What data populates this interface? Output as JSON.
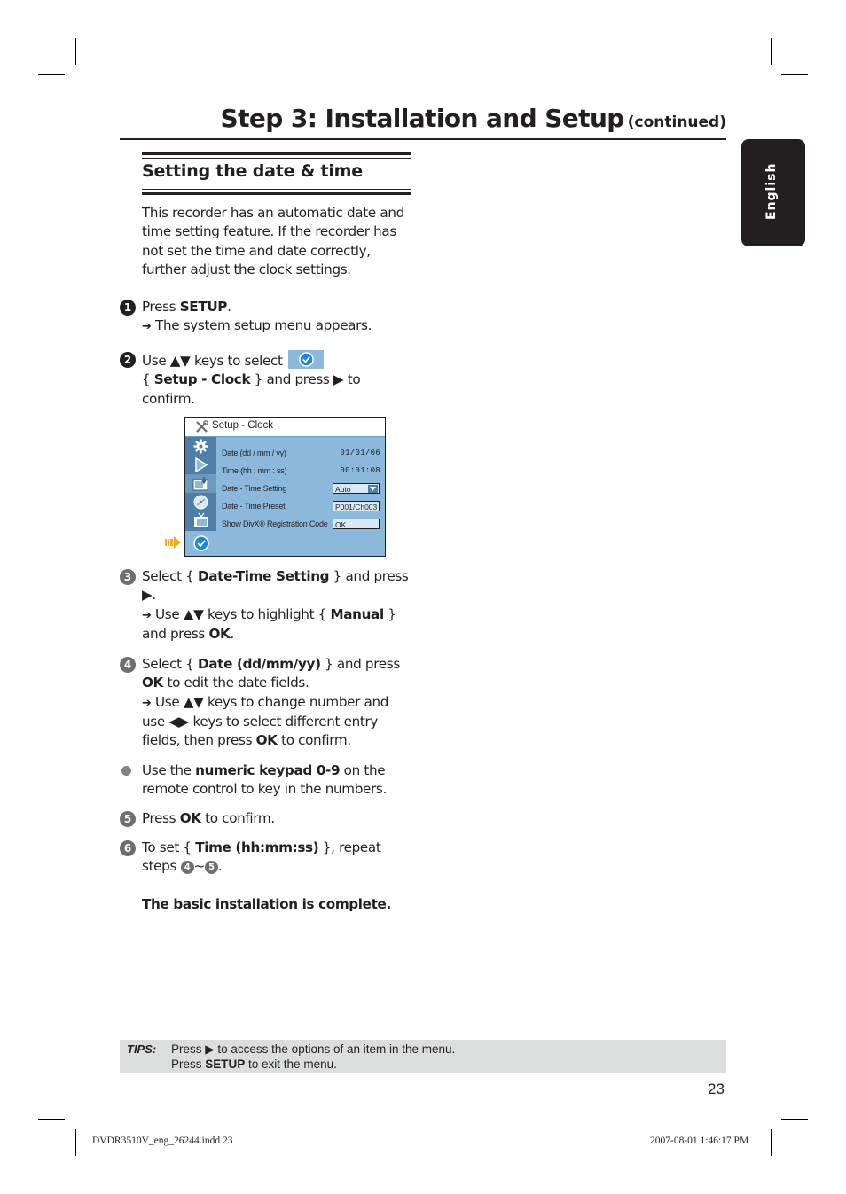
{
  "header": {
    "title": "Step 3: Installation and Setup",
    "continued": "(continued)"
  },
  "language_tab": "English",
  "section": {
    "title": "Setting the date & time",
    "intro": [
      "This recorder has an automatic date and",
      "time setting feature. If the recorder has",
      "not set the time and date correctly,",
      "further adjust the clock settings."
    ]
  },
  "steps": [
    {
      "num": "1",
      "lines": [
        {
          "parts": [
            {
              "t": "Press "
            },
            {
              "t": "SETUP",
              "b": true
            },
            {
              "t": "."
            }
          ]
        },
        {
          "arrow": true,
          "parts": [
            {
              "t": " The system setup menu appears."
            }
          ]
        }
      ]
    },
    {
      "num": "2",
      "lines": [
        {
          "parts": [
            {
              "t": "Use ▲▼ keys to select "
            }
          ],
          "chip": "clock-icon"
        },
        {
          "parts": [
            {
              "t": "{ "
            },
            {
              "t": "Setup - Clock",
              "b": true
            },
            {
              "t": " } and press ▶ to"
            }
          ]
        },
        {
          "parts": [
            {
              "t": "confirm."
            }
          ]
        }
      ]
    },
    {
      "num": "3",
      "lines": [
        {
          "parts": [
            {
              "t": "Select { "
            },
            {
              "t": "Date-Time Setting",
              "b": true
            },
            {
              "t": " } and press"
            }
          ]
        },
        {
          "parts": [
            {
              "t": "▶."
            }
          ]
        },
        {
          "arrow": true,
          "parts": [
            {
              "t": "  Use ▲▼ keys to highlight { "
            },
            {
              "t": "Manual",
              "b": true
            },
            {
              "t": " }"
            }
          ]
        },
        {
          "parts": [
            {
              "t": "and press "
            },
            {
              "t": "OK",
              "b": true
            },
            {
              "t": "."
            }
          ]
        }
      ]
    },
    {
      "num": "4",
      "lines": [
        {
          "parts": [
            {
              "t": "Select { "
            },
            {
              "t": "Date (dd/mm/yy)",
              "b": true
            },
            {
              "t": " } and press"
            }
          ]
        },
        {
          "parts": [
            {
              "t": "OK",
              "b": true
            },
            {
              "t": " to edit the date fields."
            }
          ]
        },
        {
          "arrow": true,
          "parts": [
            {
              "t": "  Use ▲▼ keys to change number and"
            }
          ]
        },
        {
          "parts": [
            {
              "t": "use ◀▶ keys to select different entry"
            }
          ]
        },
        {
          "parts": [
            {
              "t": "fields, then press "
            },
            {
              "t": "OK",
              "b": true
            },
            {
              "t": " to confirm."
            }
          ]
        }
      ]
    },
    {
      "bullet": true,
      "lines": [
        {
          "parts": [
            {
              "t": "Use the "
            },
            {
              "t": "numeric keypad 0-9",
              "b": true
            },
            {
              "t": " on the"
            }
          ]
        },
        {
          "parts": [
            {
              "t": "remote control to key in the numbers."
            }
          ]
        }
      ]
    },
    {
      "num": "5",
      "lines": [
        {
          "parts": [
            {
              "t": "Press "
            },
            {
              "t": "OK",
              "b": true
            },
            {
              "t": " to confirm."
            }
          ]
        }
      ]
    },
    {
      "num": "6",
      "lines": [
        {
          "parts": [
            {
              "t": "To set { "
            },
            {
              "t": "Time (hh:mm:ss)",
              "b": true
            },
            {
              "t": " }, repeat"
            }
          ]
        },
        {
          "parts": [
            {
              "t": "steps "
            },
            {
              "n": "4"
            },
            {
              "t": "~"
            },
            {
              "n": "5"
            },
            {
              "t": "."
            }
          ]
        }
      ]
    }
  ],
  "completion": "The basic installation is complete.",
  "osd": {
    "title": "Setup - Clock",
    "sidebar_icons": [
      "gear-icon",
      "play-icon",
      "record-icon",
      "disc-icon",
      "tv-icon",
      "clock-icon"
    ],
    "rows": [
      {
        "label": "Date (dd / mm / yy)",
        "value": "01/01/06",
        "type": "text"
      },
      {
        "label": "Time (hh : mm : ss)",
        "value": "00:01:08",
        "type": "text"
      },
      {
        "label": "Date - Time Setting",
        "value": "Auto",
        "type": "dropdown"
      },
      {
        "label": "Date - Time Preset",
        "value": "P001/Ch003",
        "type": "box"
      },
      {
        "label": "Show DivX® Registration Code",
        "value": "OK",
        "type": "box"
      }
    ]
  },
  "tips": {
    "label": "TIPS:",
    "line1": [
      {
        "t": "Press ▶ to access the options of an item in the menu."
      }
    ],
    "line2": [
      {
        "t": "Press "
      },
      {
        "t": "SETUP",
        "b": true
      },
      {
        "t": " to exit the menu."
      }
    ]
  },
  "page_number": "23",
  "slug": {
    "left": "DVDR3510V_eng_26244.indd   23",
    "right": "2007-08-01   1:46:17 PM"
  }
}
